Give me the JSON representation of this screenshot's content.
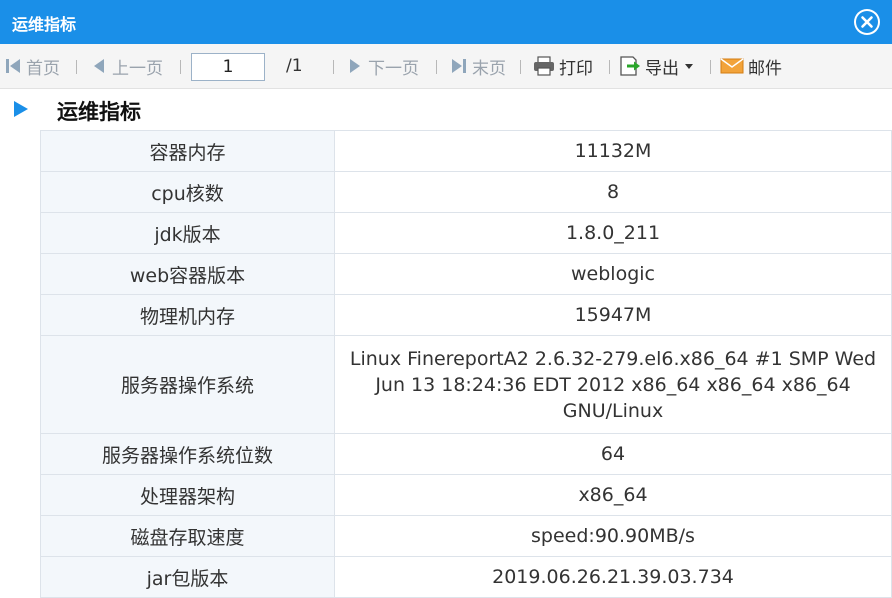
{
  "window": {
    "title": "运维指标"
  },
  "toolbar": {
    "first_page": "首页",
    "prev_page": "上一页",
    "page_value": "1",
    "page_total": "/1",
    "next_page": "下一页",
    "last_page": "末页",
    "print": "打印",
    "export": "导出",
    "email": "邮件"
  },
  "section": {
    "title": "运维指标"
  },
  "rows": [
    {
      "label": "容器内存",
      "value": "11132M"
    },
    {
      "label": "cpu核数",
      "value": "8"
    },
    {
      "label": "jdk版本",
      "value": "1.8.0_211"
    },
    {
      "label": "web容器版本",
      "value": "weblogic"
    },
    {
      "label": "物理机内存",
      "value": "15947M"
    },
    {
      "label": "服务器操作系统",
      "value": "Linux FinereportA2 2.6.32-279.el6.x86_64 #1 SMP Wed Jun 13 18:24:36 EDT 2012 x86_64 x86_64 x86_64 GNU/Linux"
    },
    {
      "label": "服务器操作系统位数",
      "value": "64"
    },
    {
      "label": "处理器架构",
      "value": "x86_64"
    },
    {
      "label": "磁盘存取速度",
      "value": "speed:90.90MB/s"
    },
    {
      "label": "jar包版本",
      "value": "2019.06.26.21.39.03.734"
    }
  ],
  "colors": {
    "titlebar": "#1a8fe8",
    "accent_arrow": "#1a8fe8"
  },
  "icons": [
    "close-icon",
    "first-page-icon",
    "prev-page-icon",
    "next-page-icon",
    "last-page-icon",
    "print-icon",
    "export-icon",
    "dropdown-arrow-icon",
    "email-icon",
    "section-arrow-icon"
  ]
}
